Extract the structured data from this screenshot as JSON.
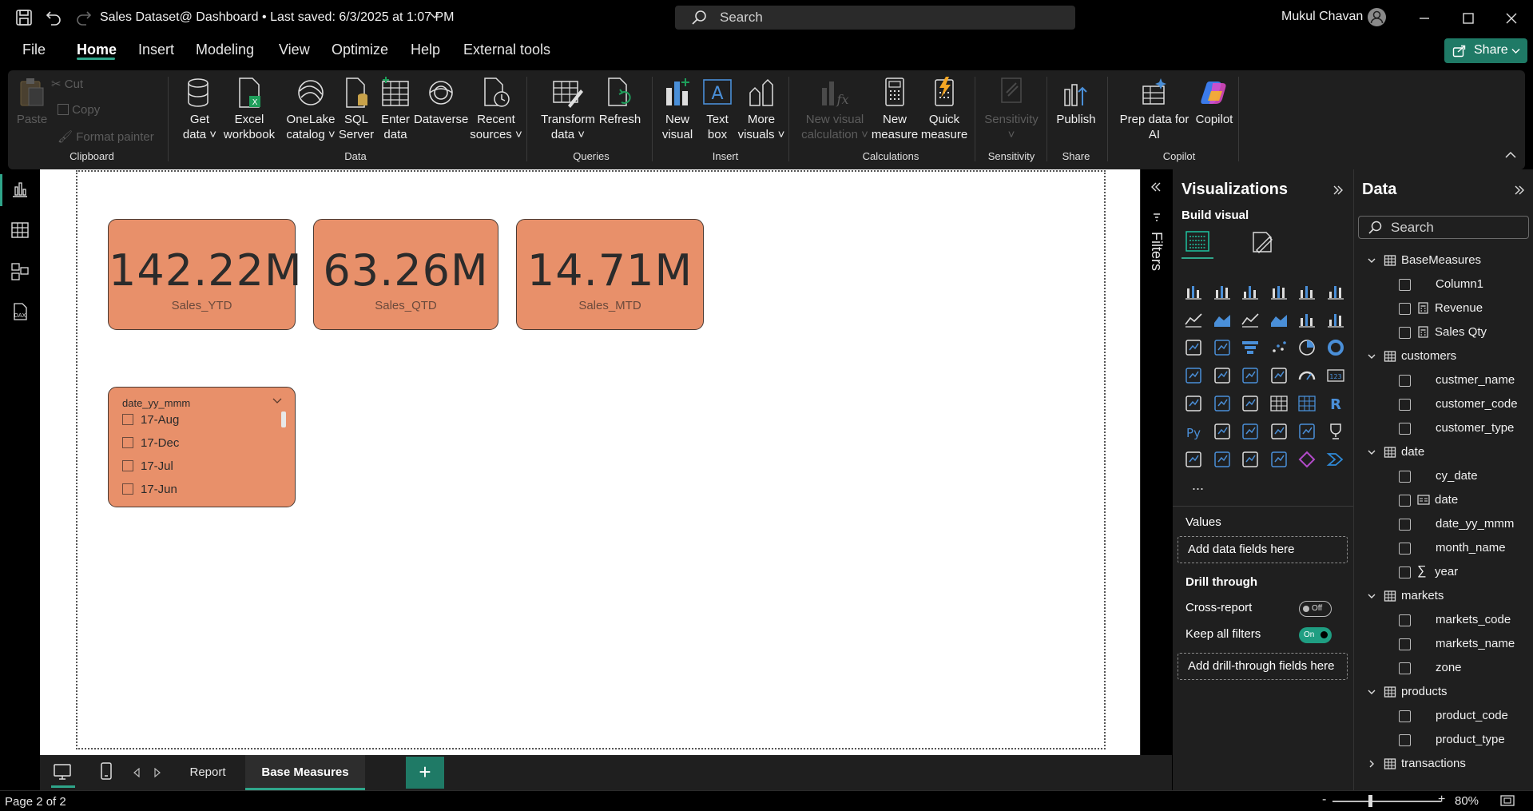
{
  "titlebar": {
    "title": "Sales Dataset@ Dashboard • Last saved: 6/3/2025 at 1:07 PM",
    "search_placeholder": "Search",
    "user_name": "Mukul Chavan"
  },
  "menu": {
    "file": "File",
    "home": "Home",
    "insert": "Insert",
    "modeling": "Modeling",
    "view": "View",
    "optimize": "Optimize",
    "help": "Help",
    "external_tools": "External tools",
    "share": "Share"
  },
  "ribbon": {
    "clipboard": {
      "paste": "Paste",
      "cut": "Cut",
      "copy": "Copy",
      "format_painter": "Format painter",
      "group": "Clipboard"
    },
    "data": {
      "get_data_1": "Get",
      "get_data_2": "data",
      "excel_1": "Excel",
      "excel_2": "workbook",
      "onelake_1": "OneLake",
      "onelake_2": "catalog",
      "sql_1": "SQL",
      "sql_2": "Server",
      "enter_1": "Enter",
      "enter_2": "data",
      "dataverse": "Dataverse",
      "recent_1": "Recent",
      "recent_2": "sources",
      "group": "Data"
    },
    "queries": {
      "transform_1": "Transform",
      "transform_2": "data",
      "refresh": "Refresh",
      "group": "Queries"
    },
    "insert": {
      "new_visual_1": "New",
      "new_visual_2": "visual",
      "text_box_1": "Text",
      "text_box_2": "box",
      "more_visuals_1": "More",
      "more_visuals_2": "visuals",
      "group": "Insert"
    },
    "calculations": {
      "new_visual_calc_1": "New visual",
      "new_visual_calc_2": "calculation",
      "new_measure_1": "New",
      "new_measure_2": "measure",
      "quick_measure_1": "Quick",
      "quick_measure_2": "measure",
      "group": "Calculations"
    },
    "sensitivity": {
      "label": "Sensitivity",
      "group": "Sensitivity"
    },
    "share": {
      "publish": "Publish",
      "group": "Share"
    },
    "copilot": {
      "prep_1": "Prep data for",
      "prep_2": "AI",
      "copilot": "Copilot",
      "group": "Copilot"
    }
  },
  "canvas": {
    "cards": [
      {
        "value": "142.22M",
        "label": "Sales_YTD"
      },
      {
        "value": "63.26M",
        "label": "Sales_QTD"
      },
      {
        "value": "14.71M",
        "label": "Sales_MTD"
      }
    ],
    "slicer": {
      "title": "date_yy_mmm",
      "items": [
        "17-Aug",
        "17-Dec",
        "17-Jul",
        "17-Jun"
      ]
    },
    "card_color": "#e8906a"
  },
  "filters": {
    "label": "Filters"
  },
  "tabs": {
    "report": "Report",
    "base_measures": "Base Measures",
    "add": "+"
  },
  "status": {
    "page": "Page 2 of 2",
    "zoom": "80%"
  },
  "visualizations": {
    "title": "Visualizations",
    "build_visual": "Build visual",
    "values_label": "Values",
    "values_drop": "Add data fields here",
    "drill_through": "Drill through",
    "cross_report": "Cross-report",
    "cross_report_state": "Off",
    "keep_filters": "Keep all filters",
    "keep_filters_state": "On",
    "drill_drop": "Add drill-through fields here",
    "more": "..."
  },
  "data_pane": {
    "title": "Data",
    "search_placeholder": "Search",
    "tables": [
      {
        "name": "BaseMeasures",
        "fields": [
          "Column1",
          "Revenue",
          "Sales Qty"
        ]
      },
      {
        "name": "customers",
        "fields": [
          "custmer_name",
          "customer_code",
          "customer_type"
        ]
      },
      {
        "name": "date",
        "fields": [
          "cy_date",
          "date",
          "date_yy_mmm",
          "month_name",
          "year"
        ]
      },
      {
        "name": "markets",
        "fields": [
          "markets_code",
          "markets_name",
          "zone"
        ]
      },
      {
        "name": "products",
        "fields": [
          "product_code",
          "product_type"
        ]
      },
      {
        "name": "transactions",
        "fields": []
      }
    ]
  },
  "colors": {
    "accent": "#2fa58a",
    "share_btn": "#1f7a66",
    "ribbon_bg": "#1f1f1f"
  }
}
